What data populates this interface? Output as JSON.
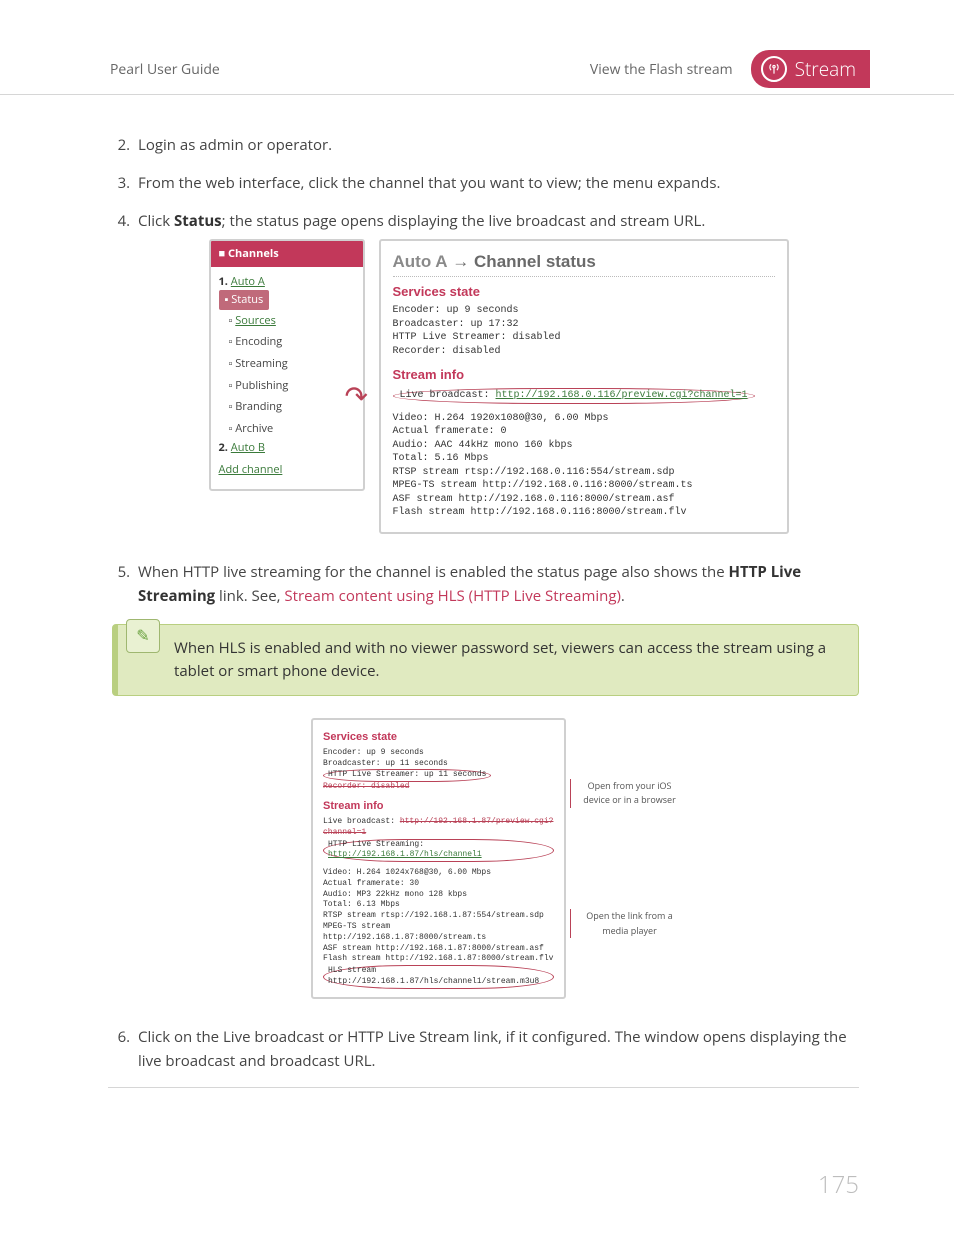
{
  "header": {
    "left": "Pearl User Guide",
    "center": "View the Flash stream",
    "badge": "Stream"
  },
  "steps": {
    "s2": "Login as admin or operator.",
    "s3": "From the web interface, click the channel that you want to view; the menu expands.",
    "s4_pre": "Click ",
    "s4_b": "Status",
    "s4_post": "; the status page opens displaying the live broadcast and stream URL.",
    "s5_a": "When HTTP live streaming for the channel is enabled the status page also shows the ",
    "s5_b": "HTTP Live Streaming",
    "s5_c": " link. See, ",
    "s5_link": "Stream content using HLS (HTTP Live Streaming)",
    "s5_d": ".",
    "s6": "Click on the Live broadcast or HTTP Live Stream link, if it configured. The window opens displaying the live broadcast and broadcast URL."
  },
  "tip": "When HLS is enabled and with no viewer password set, viewers can access the stream using a tablet or smart phone device.",
  "sidebar": {
    "head": "Channels",
    "ch1_num": "1.",
    "ch1": "Auto A",
    "status": "Status",
    "sources": "Sources",
    "encoding": "Encoding",
    "streaming": "Streaming",
    "publishing": "Publishing",
    "branding": "Branding",
    "archive": "Archive",
    "ch2_num": "2.",
    "ch2": "Auto B",
    "add": "Add channel"
  },
  "panel1": {
    "title_a": "Auto A",
    "title_arrow": " → ",
    "title_b": "Channel status",
    "svc_head": "Services state",
    "encoder": "Encoder: up 9 seconds",
    "broadcaster": "Broadcaster: up 17:32",
    "http_live": "HTTP Live Streamer: disabled",
    "recorder": "Recorder: disabled",
    "stream_head": "Stream info",
    "live_label": "Live broadcast: ",
    "live_url": "http://192.168.0.116/preview.cgi?channel=1",
    "video": "Video: H.264 1920x1080@30, 6.00 Mbps",
    "fps": "Actual framerate: 0",
    "audio": "Audio: AAC 44kHz mono 160 kbps",
    "total": "Total: 5.16 Mbps",
    "rtsp": "RTSP stream rtsp://192.168.0.116:554/stream.sdp",
    "mpegts": "MPEG-TS stream http://192.168.0.116:8000/stream.ts",
    "asf": "ASF stream http://192.168.0.116:8000/stream.asf",
    "flash": "Flash stream http://192.168.0.116:8000/stream.flv"
  },
  "panel2": {
    "svc_head": "Services state",
    "encoder": "Encoder: up 9 seconds",
    "broadcaster": "Broadcaster: up 11 seconds",
    "http_live": "HTTP Live Streamer: up 11 seconds",
    "recorder": "Recorder: disabled",
    "stream_head": "Stream info",
    "live_label": "Live broadcast: ",
    "live_url": "http://192.168.1.87/preview.cgi?channel=1",
    "hls_label": "HTTP Live Streaming: ",
    "hls_url": "http://192.168.1.87/hls/channel1",
    "video": "Video: H.264 1024x768@30, 6.00 Mbps",
    "fps": "Actual framerate: 30",
    "audio": "Audio: MP3 22kHz mono 128 kbps",
    "total": "Total: 6.13 Mbps",
    "rtsp": "RTSP stream rtsp://192.168.1.87:554/stream.sdp",
    "mpegts": "MPEG-TS stream http://192.168.1.87:8000/stream.ts",
    "asf": "ASF stream http://192.168.1.87:8000/stream.asf",
    "flash": "Flash stream http://192.168.1.87:8000/stream.flv",
    "hls2": "HLS stream http://192.168.1.87/hls/channel1/stream.m3u8"
  },
  "callouts": {
    "top": "Open from your iOS device or in a browser",
    "bottom": "Open the link from a media player"
  },
  "page_number": "175"
}
